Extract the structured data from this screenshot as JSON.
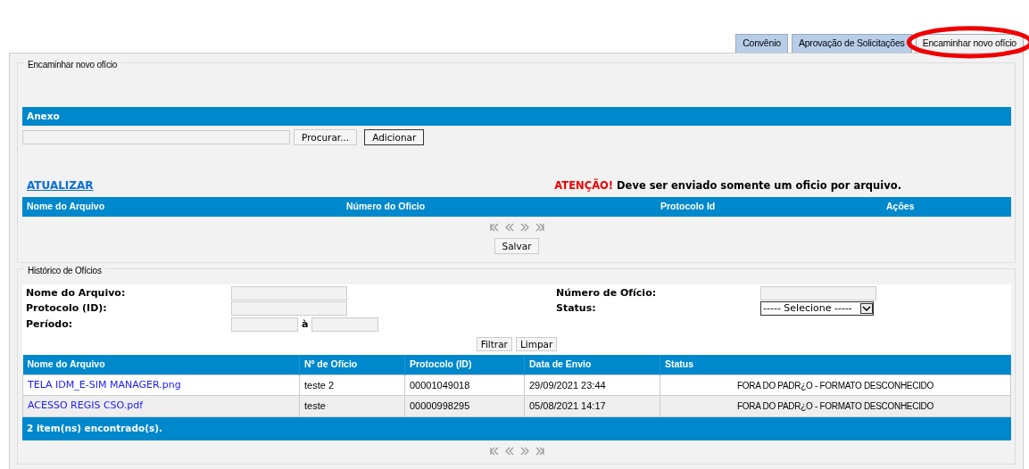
{
  "tabs": [
    {
      "label": "Convênio",
      "selected": false,
      "highlighted": false
    },
    {
      "label": "Aprovação de Solicitações",
      "selected": false,
      "highlighted": false
    },
    {
      "label": "Encaminhar novo ofício",
      "selected": true,
      "highlighted": true
    }
  ],
  "send_section": {
    "legend": "Encaminhar novo ofício",
    "attachment_header": "Anexo",
    "browse_button": "Procurar...",
    "add_button": "Adicionar",
    "refresh_link": "ATUALIZAR",
    "warning_label": "ATENÇÃO!",
    "warning_text": "Deve ser enviado somente um oficio por arquivo.",
    "columns": [
      "Nome do Arquivo",
      "Número do Oficio",
      "Protocolo Id",
      "Ações"
    ],
    "save_button": "Salvar"
  },
  "history": {
    "legend": "Histórico de Ofícios",
    "filters": [
      {
        "label": "Nome do Arquivo:",
        "kind": "text"
      },
      {
        "label": "Número de Ofício:",
        "kind": "text"
      },
      {
        "label": "Protocolo (ID):",
        "kind": "text"
      },
      {
        "label": "Status:",
        "kind": "select",
        "value": "----- Selecione -----"
      },
      {
        "label": "Período:",
        "kind": "range",
        "separator": "à"
      }
    ],
    "filter_button": "Filtrar",
    "clear_button": "Limpar",
    "columns": [
      "Nome do Arquivo",
      "Nº de Ofício",
      "Protocolo (ID)",
      "Data de Envio",
      "Status"
    ],
    "rows": [
      [
        "TELA IDM_E-SIM MANAGER.png",
        "teste 2",
        "00001049018",
        "29/09/2021 23:44",
        "FORA DO PADR¿O - FORMATO DESCONHECIDO"
      ],
      [
        "ACESSO REGIS CSO.pdf",
        "teste",
        "00000998295",
        "05/08/2021 14:17",
        "FORA DO PADR¿O - FORMATO DESCONHECIDO"
      ]
    ],
    "footer": "2 item(ns) encontrado(s)."
  }
}
